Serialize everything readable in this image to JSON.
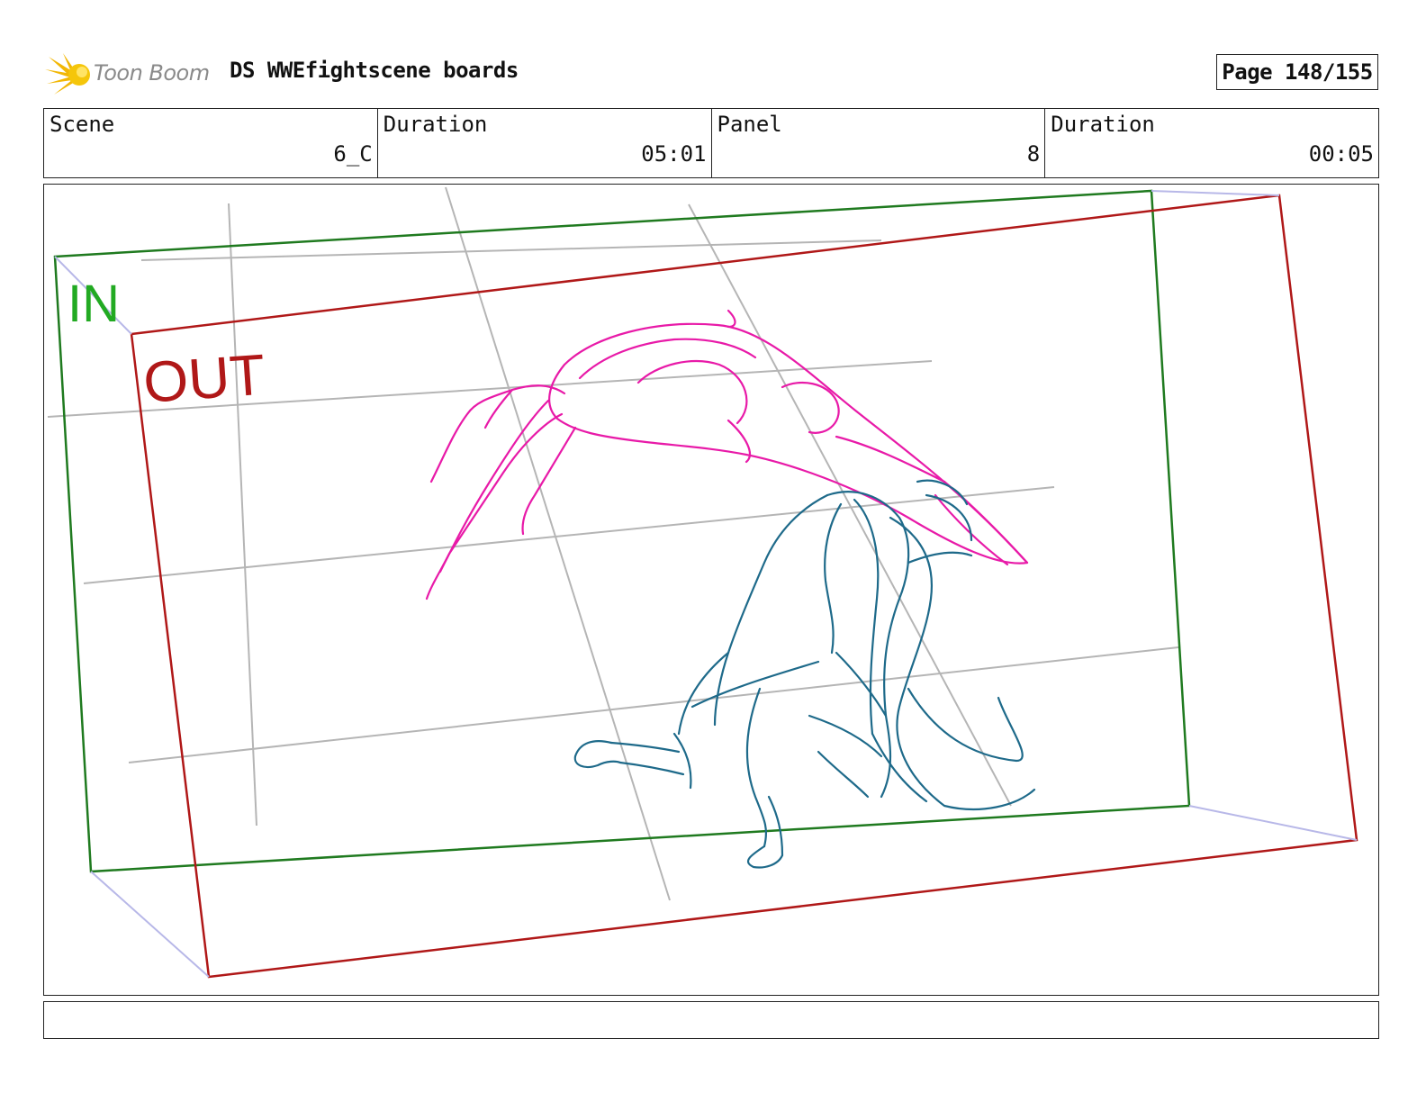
{
  "header": {
    "logo_text": "Toon Boom",
    "project_title": "DS WWEfightscene boards",
    "page_label": "Page 148/155"
  },
  "info": [
    {
      "label": "Scene",
      "value": "6_C"
    },
    {
      "label": "Duration",
      "value": "05:01"
    },
    {
      "label": "Panel",
      "value": "8"
    },
    {
      "label": "Duration",
      "value": "00:05"
    }
  ],
  "panel": {
    "in_label": "IN",
    "out_label": "OUT",
    "colors": {
      "in_frame": "#1f7a1f",
      "in_text": "#22aa22",
      "out_frame": "#b01818",
      "grid": "#b5b5b5",
      "connector": "#b8b8e8",
      "figure_pink": "#e81aa8",
      "figure_blue": "#1e6a8a"
    }
  },
  "caption": {
    "text": ""
  }
}
